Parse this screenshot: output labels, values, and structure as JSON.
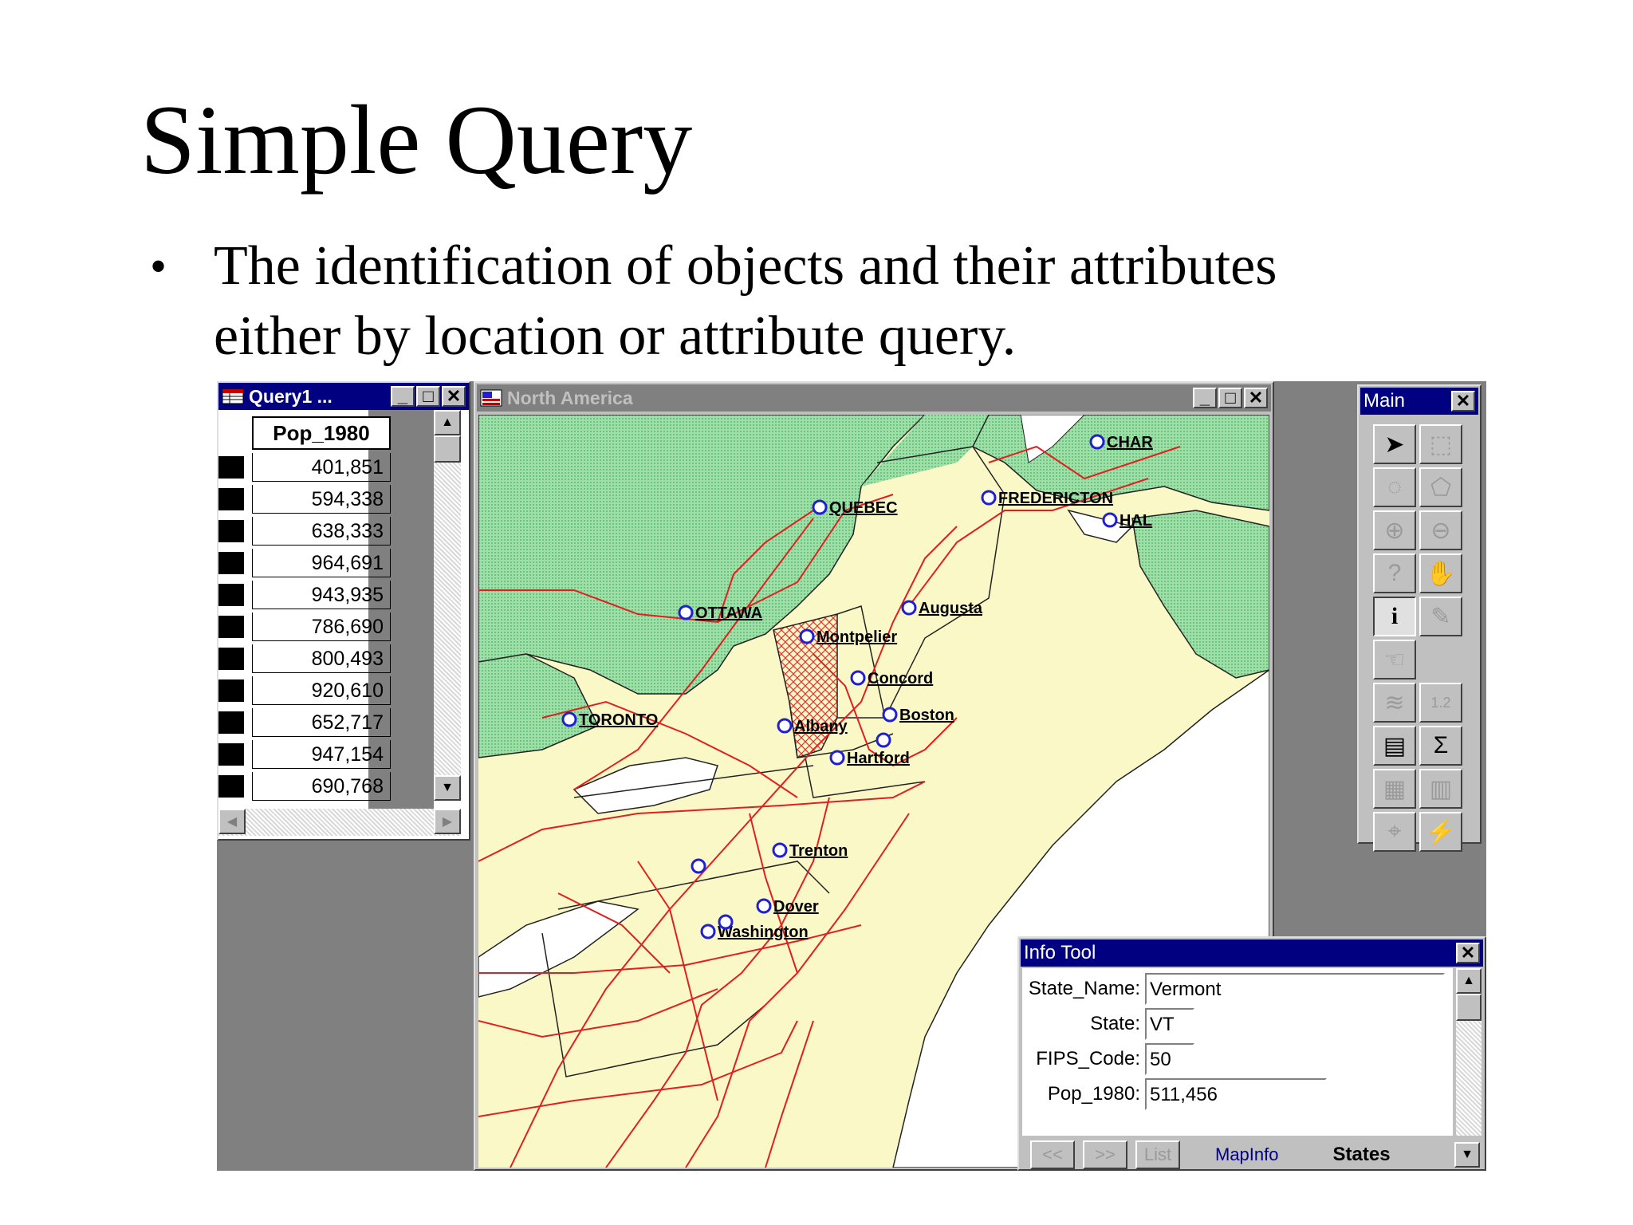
{
  "slide": {
    "title": "Simple Query",
    "bullet": "The identification of objects and their attributes either by location or attribute query."
  },
  "query_window": {
    "title": "Query1 ...",
    "column_header": "Pop_1980",
    "values": [
      "401,851",
      "594,338",
      "638,333",
      "964,691",
      "943,935",
      "786,690",
      "800,493",
      "920,610",
      "652,717",
      "947,154",
      "690,768"
    ]
  },
  "map_window": {
    "title": "North America",
    "cities": [
      "CHAR",
      "QUEBEC",
      "FREDERICTON",
      "HAL",
      "OTTAWA",
      "Augusta",
      "Montpelier",
      "Concord",
      "TORONTO",
      "Boston",
      "Albany",
      "Hartford",
      "Trenton",
      "Dover",
      "Washington"
    ]
  },
  "main_toolbar": {
    "title": "Main",
    "tools": [
      "select-arrow-icon",
      "marquee-select-icon",
      "radius-select-icon",
      "region-select-icon",
      "zoom-in-icon",
      "zoom-out-icon",
      "change-view-icon",
      "grabber-hand-icon",
      "info-tool-icon",
      "label-tool-icon",
      "drag-window-icon",
      "layer-control-icon",
      "ruler-icon",
      "browse-icon",
      "statistics-icon",
      "legend-icon",
      "graph-icon",
      "show-hide-icon",
      "hotlink-icon"
    ]
  },
  "info_tool": {
    "title": "Info Tool",
    "fields": [
      {
        "label": "State_Name:",
        "value": "Vermont"
      },
      {
        "label": "State:",
        "value": "VT"
      },
      {
        "label": "FIPS_Code:",
        "value": "50"
      },
      {
        "label": "Pop_1980:",
        "value": "511,456"
      }
    ],
    "prev_label": "<<",
    "next_label": ">>",
    "list_label": "List",
    "brand": "MapInfo",
    "table_name": "States"
  },
  "colors": {
    "titlebar_active": "#000080",
    "water": "#8fd6a0",
    "land": "#fbf8c8",
    "roads": "#e02020",
    "city_marker": "#2020d0"
  }
}
